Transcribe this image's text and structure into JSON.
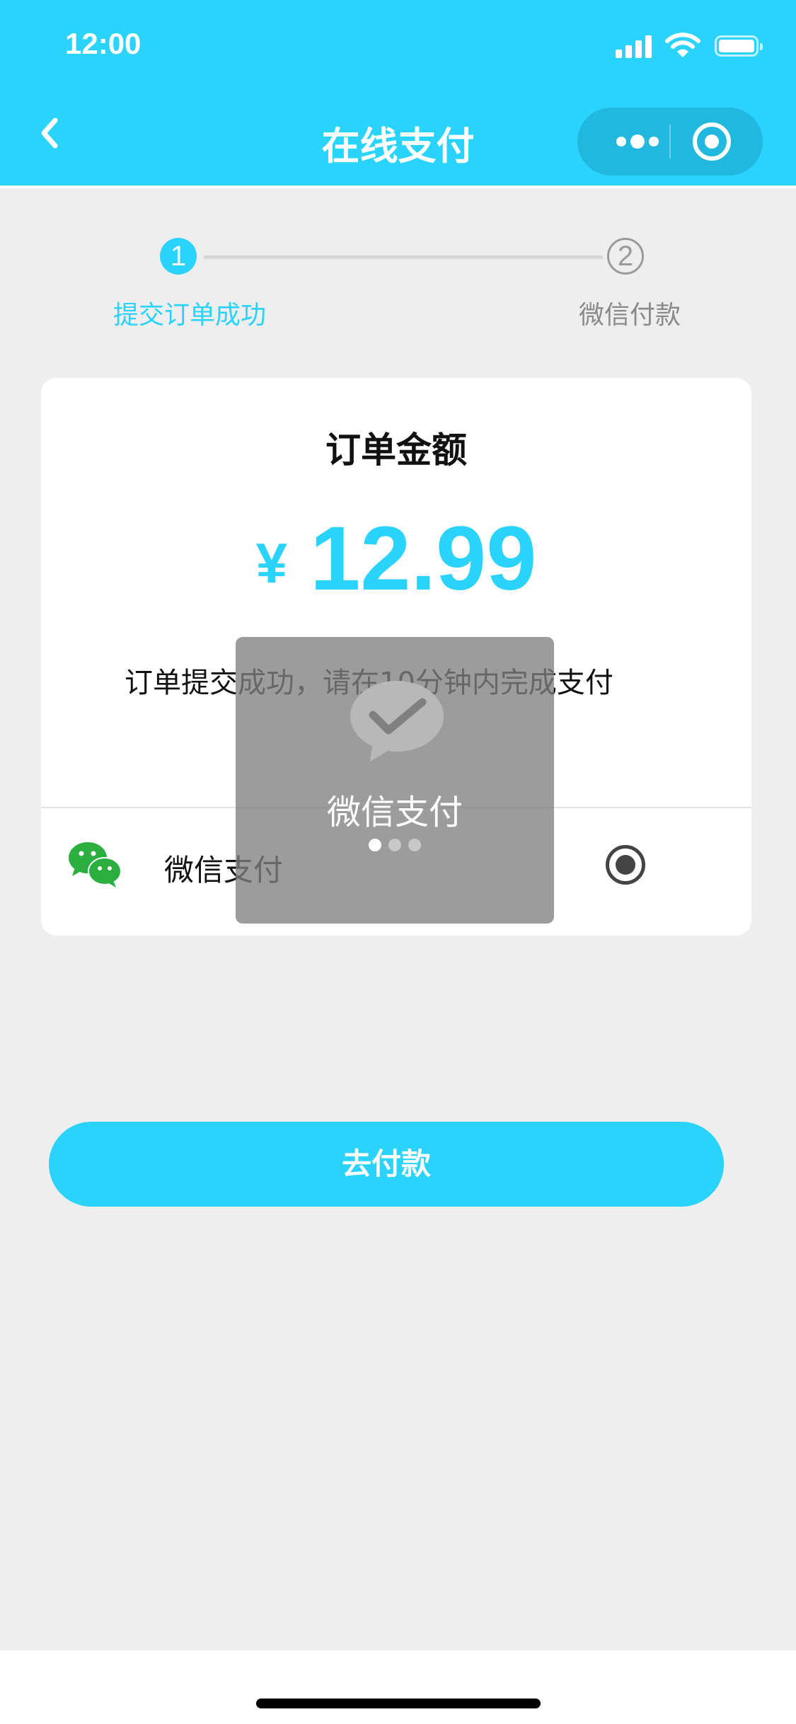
{
  "status_bar": {
    "time": "12:00"
  },
  "nav": {
    "title": "在线支付"
  },
  "steps": [
    {
      "number": "1",
      "label": "提交订单成功",
      "state": "active"
    },
    {
      "number": "2",
      "label": "微信付款",
      "state": "pending"
    }
  ],
  "order": {
    "title": "订单金额",
    "currency": "¥",
    "amount": "12.99",
    "notice": "订单提交成功，请在10分钟内完成支付"
  },
  "payment_method": {
    "label": "微信支付",
    "selected": true,
    "icon": "wechat-icon"
  },
  "overlay": {
    "label": "微信支付",
    "page_count": 3,
    "active_page": 1
  },
  "pay_button": {
    "label": "去付款"
  },
  "colors": {
    "accent": "#29d3fb",
    "background": "#eeeeee",
    "card": "#ffffff"
  }
}
